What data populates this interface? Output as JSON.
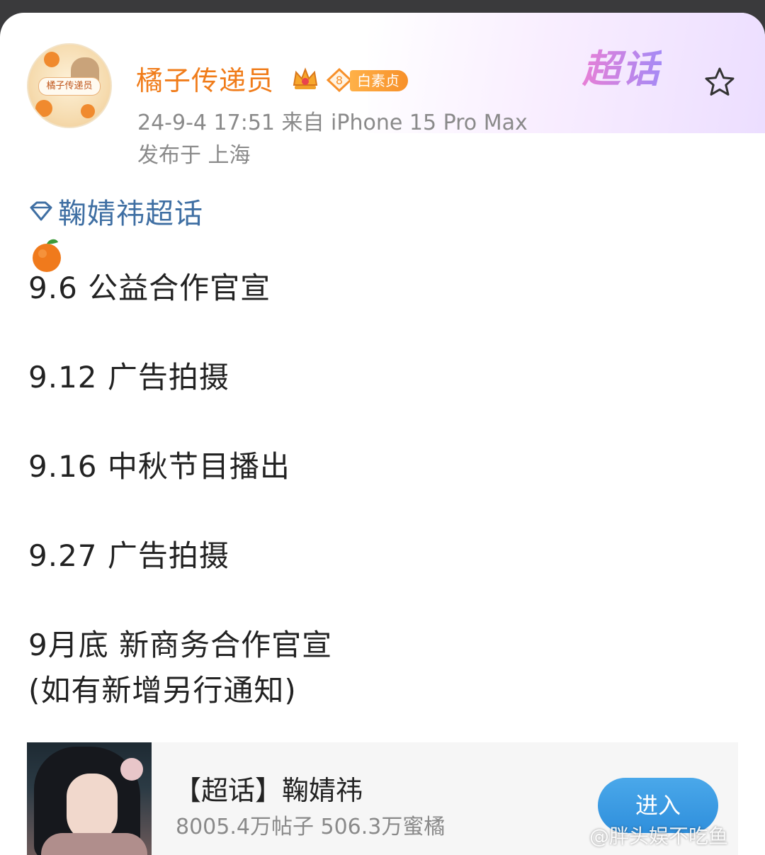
{
  "post": {
    "username": "橘子传递员",
    "badge_level": "8",
    "badge_label": "白素贞",
    "timestamp_source": "24-9-4 17:51  来自 iPhone 15 Pro Max",
    "location": "发布于 上海",
    "header_brand": "超话",
    "topic": "鞠婧祎超话",
    "emoji": "🍊",
    "lines": [
      "9.6 公益合作官宣",
      "9.12 广告拍摄",
      "9.16 中秋节目播出",
      "9.27 广告拍摄",
      "9月底 新商务合作官宣",
      "(如有新增另行通知)"
    ]
  },
  "super_topic_card": {
    "title": "【超话】鞠婧祎",
    "stats": "8005.4万帖子 506.3万蜜橘",
    "enter_label": "进入"
  },
  "watermark": "@胖头娱不吃鱼",
  "avatar_label": "橘子传递员",
  "colors": {
    "username": "#f07c1a",
    "topic": "#3f6fa3",
    "enter_button": "#3a9ae3",
    "badge": "#f7902a"
  },
  "icons": {
    "star": "star-outline-icon",
    "topic": "diamond-icon",
    "crown": "crown-icon"
  }
}
